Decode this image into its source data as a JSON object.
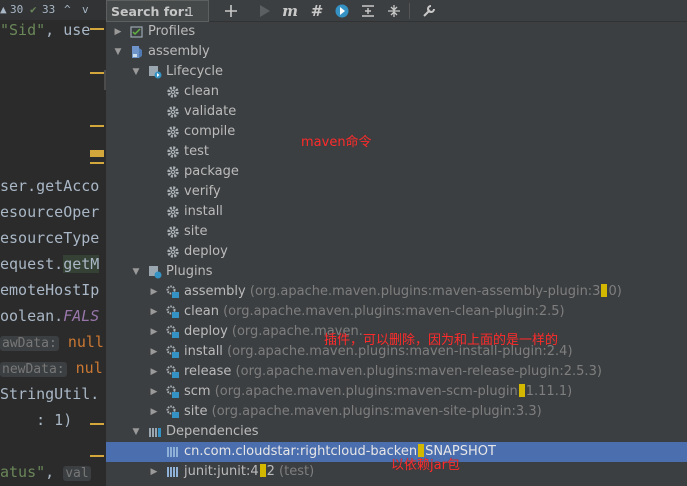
{
  "editor": {
    "gutter": {
      "count_left": "30",
      "count_right": "33",
      "up_arrow": "^",
      "down_arrow": "v"
    },
    "lines": [
      {
        "pre": "\"Sid\"",
        "mid": ", use",
        "post": ""
      },
      {
        "pre": "ser.getAcco"
      },
      {
        "pre": "esourceOper"
      },
      {
        "pre": "esourceType"
      },
      {
        "pre": "equest.",
        "hl": "getM"
      },
      {
        "pre": "emoteHostIp"
      },
      {
        "pre": "oolean.",
        "ital": "FALS"
      },
      {
        "hint": "awData:",
        "kw": " null"
      },
      {
        "hint": "newData:",
        "kw": " nul"
      },
      {
        "pre": "StringUtil."
      },
      {
        "pre": "    : 1)"
      },
      {
        "str": "atus\"",
        "mid": ", ",
        "hint": "val"
      }
    ]
  },
  "toolbar": {
    "search_label": "Search for:",
    "search_value": "1",
    "icons": [
      "add-icon",
      "run-icon",
      "maven-goal-icon",
      "toggle-offline-icon",
      "lifecycle-icon",
      "collapse-all-icon",
      "expand-all-icon",
      "settings-wrench-icon"
    ],
    "maven_glyph": "m",
    "offline_glyph": "#"
  },
  "tree": {
    "profiles": "Profiles",
    "project": "assembly",
    "lifecycle": {
      "label": "Lifecycle",
      "goals": [
        "clean",
        "validate",
        "compile",
        "test",
        "package",
        "verify",
        "install",
        "site",
        "deploy"
      ]
    },
    "plugins": {
      "label": "Plugins",
      "items": [
        {
          "name": "assembly",
          "coord_a": "(org.apache.maven.plugins:maven-assembly-plugin:3",
          "coord_b": "0)"
        },
        {
          "name": "clean",
          "coord_a": "(org.apache.maven.plugins:maven-clean-plugin:2.5)",
          "coord_b": ""
        },
        {
          "name": "deploy",
          "coord_a": "(org.apache.maven.",
          "coord_b": ""
        },
        {
          "name": "install",
          "coord_a": "(org.apache.maven.plugins:maven-install-plugin:2.4)",
          "coord_b": ""
        },
        {
          "name": "release",
          "coord_a": "(org.apache.maven.plugins:maven-release-plugin:2.5.3)",
          "coord_b": ""
        },
        {
          "name": "scm",
          "coord_a": "(org.apache.maven.plugins:maven-scm-plugin",
          "coord_b": "1.11.1)"
        },
        {
          "name": "site",
          "coord_a": "(org.apache.maven.plugins:maven-site-plugin:3.3)",
          "coord_b": ""
        }
      ]
    },
    "dependencies": {
      "label": "Dependencies",
      "items": [
        {
          "name_a": "cn.com.cloudstar:rightcloud-backen",
          "name_b": "SNAPSHOT",
          "selected": true
        },
        {
          "name_a": "junit:junit:4",
          "name_b": "2 ",
          "scope": "(test)",
          "selected": false
        }
      ]
    }
  },
  "annotations": {
    "maven_commands": "maven命令",
    "plugins_note": "插件，可以删除，因为和上面的是一样的",
    "dependency_note": "以依赖jar包"
  },
  "colors": {
    "accent_selection": "#4b6eaf",
    "annotation": "#ff2b2b",
    "highlight_marker": "#d4b800"
  }
}
